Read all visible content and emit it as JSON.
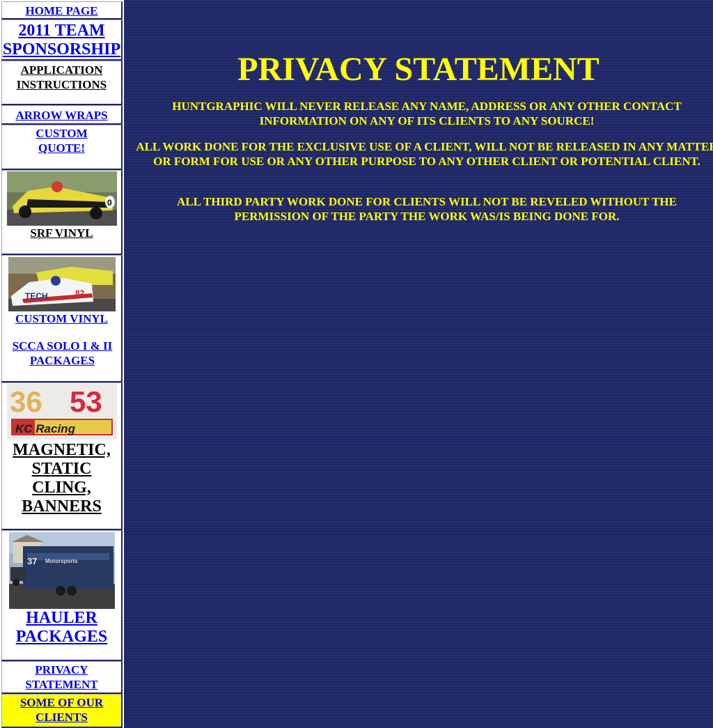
{
  "sidebar": {
    "home": "HOME PAGE",
    "team_sponsorship": "2011 TEAM SPONSORSHIP",
    "application_instructions": "APPLICATION INSTRUCTIONS",
    "arrow_wraps": "ARROW WRAPS",
    "custom_quote": "CUSTOM QUOTE!",
    "srf_vinyl": "SRF VINYL",
    "custom_vinyl": "CUSTOM VINYL",
    "scca_solo": "SCCA SOLO I & II PACKAGES",
    "magnetic": "MAGNETIC, STATIC CLING, BANNERS",
    "hauler": "HAULER PACKAGES",
    "privacy": "PRIVACY STATEMENT",
    "clients": "SOME OF OUR CLIENTS"
  },
  "images": {
    "srf_car_number": "0",
    "custom_car_number": "82",
    "custom_car_text": "TECH",
    "banner_numbers": [
      "36",
      "53"
    ],
    "banner_logo": "KC Racing",
    "hauler_number": "37",
    "hauler_text": "Motorsports"
  },
  "main": {
    "title": "PRIVACY STATEMENT",
    "paragraphs": [
      "HUNTGRAPHIC WILL NEVER RELEASE ANY NAME, ADDRESS OR ANY OTHER CONTACT INFORMATION ON ANY OF ITS CLIENTS TO ANY SOURCE!",
      "ALL WORK DONE FOR THE EXCLUSIVE USE OF A CLIENT, WILL NOT BE RELEASED IN ANY MATTER OR FORM FOR USE OR ANY OTHER PURPOSE TO ANY OTHER CLIENT OR POTENTIAL CLIENT.",
      "ALL THIRD PARTY WORK DONE FOR CLIENTS WILL NOT BE REVELED WITHOUT THE PERMISSION OF THE PARTY THE WORK WAS/IS BEING DONE FOR."
    ]
  },
  "colors": {
    "background": "#232a6b",
    "text_yellow": "#ffff00",
    "link_blue": "#0000ee",
    "highlight_cell": "#ffff00"
  }
}
